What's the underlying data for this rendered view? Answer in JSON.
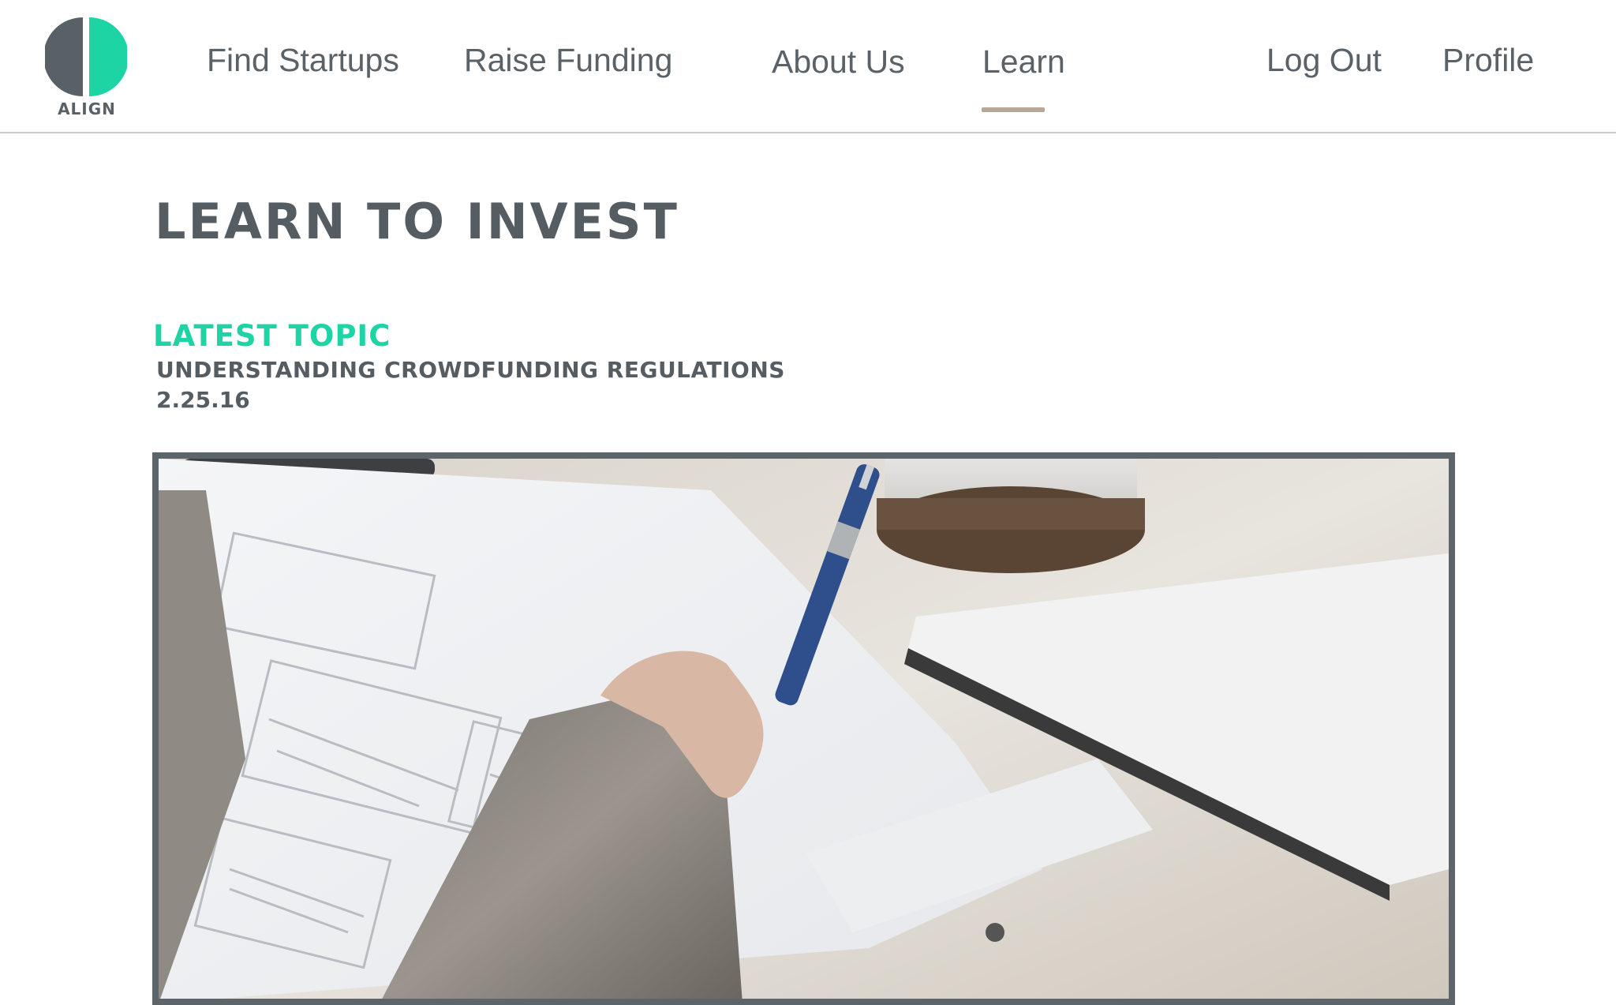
{
  "brand": {
    "name": "ALIGN",
    "colors": {
      "dark": "#596167",
      "accent": "#1dd5a4",
      "underline": "#b5a898"
    }
  },
  "nav": {
    "find_startups": "Find Startups",
    "raise_funding": "Raise Funding",
    "about_us": "About Us",
    "learn": "Learn",
    "log_out": "Log Out",
    "profile": "Profile",
    "active": "learn"
  },
  "page": {
    "title": "LEARN TO INVEST"
  },
  "latest": {
    "label": "LATEST TOPIC",
    "title": "UNDERSTANDING CROWDFUNDING REGULATIONS",
    "date": "2.25.16"
  },
  "hero": {
    "icon": "photo-hand-writing-with-pen"
  }
}
